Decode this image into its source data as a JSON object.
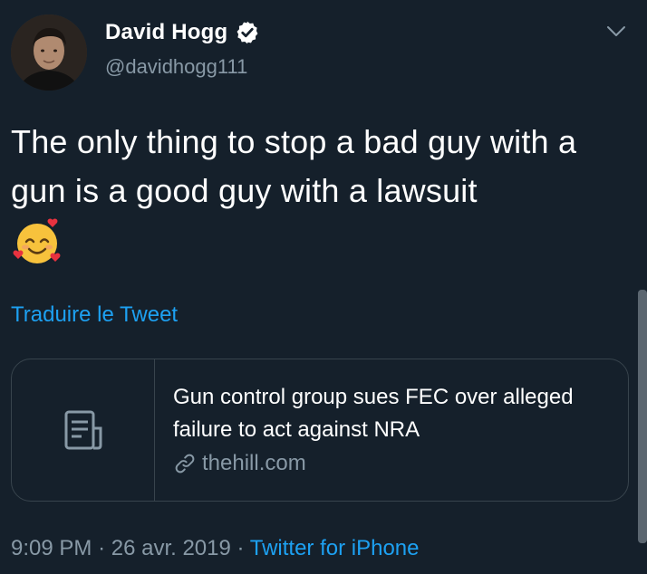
{
  "author": {
    "display_name": "David Hogg",
    "handle": "@davidhogg111",
    "verified": true,
    "avatar_icon": "profile-photo"
  },
  "tweet": {
    "text": "The only thing to stop a bad guy with a gun is a good guy with a lawsuit",
    "emoji": "smiling-face-with-hearts",
    "translate_label": "Traduire le Tweet"
  },
  "card": {
    "icon": "article-icon",
    "title": "Gun control group sues FEC over alleged failure to act against NRA",
    "domain": "thehill.com"
  },
  "meta": {
    "time": "9:09 PM",
    "separator": "·",
    "date": "26 avr. 2019",
    "source": "Twitter for iPhone"
  },
  "colors": {
    "background": "#15202b",
    "text": "#ffffff",
    "secondary_text": "#8899a6",
    "accent": "#1da1f2",
    "border": "#38444d"
  }
}
